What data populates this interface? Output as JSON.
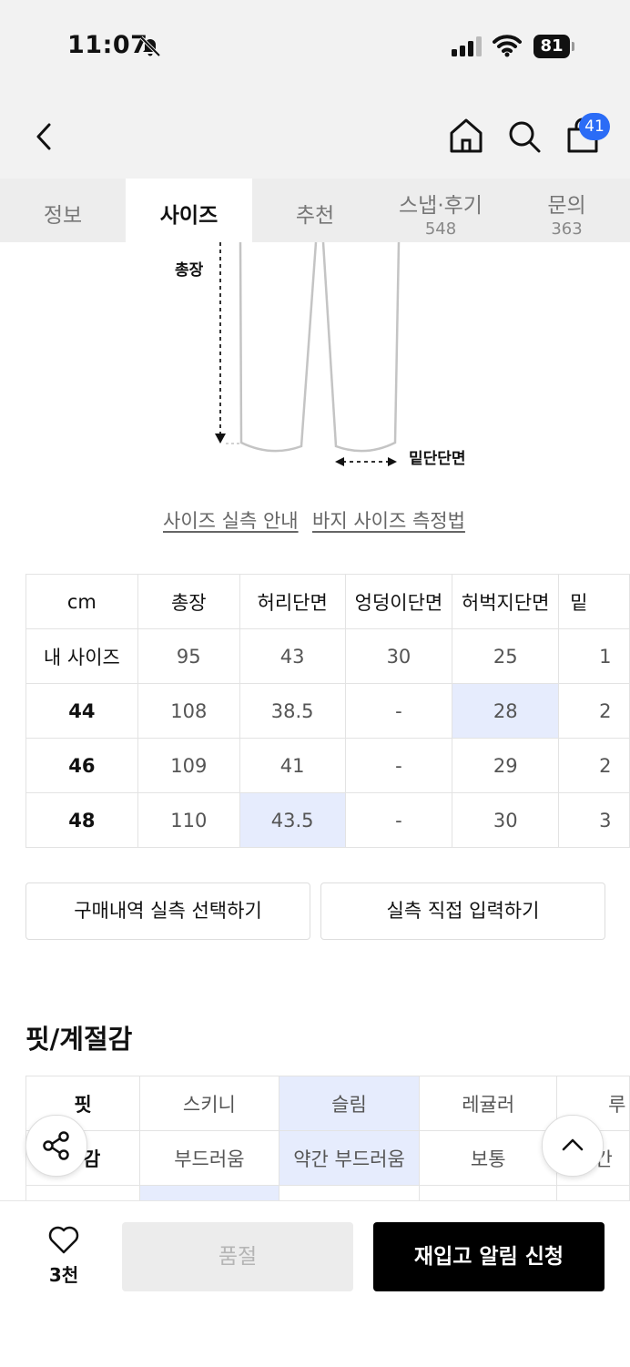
{
  "status_bar": {
    "time": "11:07",
    "battery": "81"
  },
  "header": {
    "cart_count": "41"
  },
  "tabs": [
    {
      "label": "정보",
      "count": ""
    },
    {
      "label": "사이즈",
      "count": ""
    },
    {
      "label": "추천",
      "count": ""
    },
    {
      "label": "스냅·후기",
      "count": "548"
    },
    {
      "label": "문의",
      "count": "363"
    }
  ],
  "diagram": {
    "length_label": "총장",
    "hem_label": "밑단단면"
  },
  "links": {
    "size_guide": "사이즈 실측 안내",
    "measure_guide": "바지 사이즈 측정법"
  },
  "size_table": {
    "headers": [
      "cm",
      "총장",
      "허리단면",
      "엉덩이단면",
      "허벅지단면",
      "밑"
    ],
    "rows": [
      {
        "label": "내 사이즈",
        "cells": [
          "95",
          "43",
          "30",
          "25",
          "1"
        ]
      },
      {
        "label": "44",
        "cells": [
          "108",
          "38.5",
          "-",
          "28",
          "2"
        ]
      },
      {
        "label": "46",
        "cells": [
          "109",
          "41",
          "-",
          "29",
          "2"
        ]
      },
      {
        "label": "48",
        "cells": [
          "110",
          "43.5",
          "-",
          "30",
          "3"
        ]
      }
    ]
  },
  "buttons": {
    "select_purchase": "구매내역 실측 선택하기",
    "direct_input": "실측 직접 입력하기"
  },
  "fit_section": {
    "title": "핏/계절감",
    "rows": [
      {
        "label": "핏",
        "cells": [
          "스키니",
          "슬림",
          "레귤러",
          "루"
        ]
      },
      {
        "label": "감",
        "cells": [
          "부드러움",
          "약간 부드러움",
          "보통",
          "약간"
        ]
      }
    ]
  },
  "bottom_bar": {
    "like_count": "3천",
    "sold_out": "품절",
    "restock_alert": "재입고 알림 신청"
  },
  "colors": {
    "accent": "#2b6cf6",
    "highlight": "#e6ecfd",
    "primary_button": "#000000"
  }
}
